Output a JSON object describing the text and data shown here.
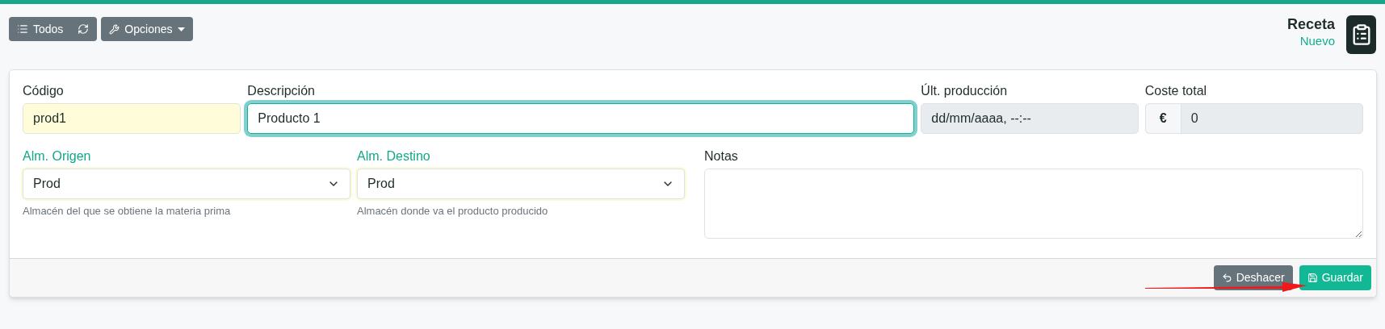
{
  "toolbar": {
    "list_button": "Todos",
    "options_button": "Opciones"
  },
  "header": {
    "title": "Receta",
    "status": "Nuevo"
  },
  "fields": [
    {
      "kind": "text",
      "label": "Código",
      "value": "prod1",
      "required": true,
      "focused": false
    },
    {
      "kind": "text",
      "label": "Descripción",
      "value": "Producto 1",
      "required": false,
      "focused": true
    },
    {
      "kind": "readonly",
      "label": "Últ. producción",
      "value": "dd/mm/aaaa, --:--"
    },
    {
      "kind": "currency",
      "label": "Coste total",
      "prefix": "€",
      "value": "0"
    }
  ],
  "selects": [
    {
      "label": "Alm. Origen",
      "value": "Prod",
      "help": "Almacén del que se obtiene la materia prima"
    },
    {
      "label": "Alm. Destino",
      "value": "Prod",
      "help": "Almacén donde va el producto producido"
    }
  ],
  "notes": {
    "label": "Notas"
  },
  "footer": {
    "undo_button": "Deshacer",
    "save_button": "Guardar"
  }
}
